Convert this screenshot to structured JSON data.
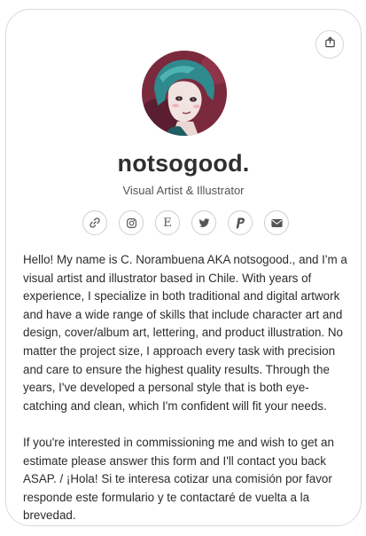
{
  "profile": {
    "name": "notsogood.",
    "subtitle": "Visual Artist & Illustrator"
  },
  "socials": [
    {
      "icon": "link-icon"
    },
    {
      "icon": "instagram-icon"
    },
    {
      "icon": "etsy-icon",
      "glyph": "E"
    },
    {
      "icon": "twitter-icon"
    },
    {
      "icon": "paypal-icon"
    },
    {
      "icon": "email-icon"
    }
  ],
  "bio": {
    "paragraph_1": "Hello! My name is C. Norambuena AKA notsogood., and I'm a visual artist and illustrator based in Chile. With years of experience, I specialize in both traditional and digital artwork and have a wide range of skills that include character art and design, cover/album art, lettering, and product illustration. No matter the project size, I approach every task with precision and care to ensure the highest quality results. Through the years, I've developed a personal style that is both eye-catching and clean, which I'm confident will fit your needs.",
    "paragraph_2": "If you're interested in commissioning me and wish to get an estimate please answer this form and I'll contact you back ASAP. / ¡Hola! Si te interesa cotizar una comisión por favor responde este formulario y te contactaré de vuelta a la brevedad."
  },
  "colors": {
    "text": "#2b2b2b",
    "muted": "#555555",
    "border": "#d9d9d9",
    "avatar_bg": "#7a2a3c",
    "avatar_hair": "#2f8a8e"
  }
}
